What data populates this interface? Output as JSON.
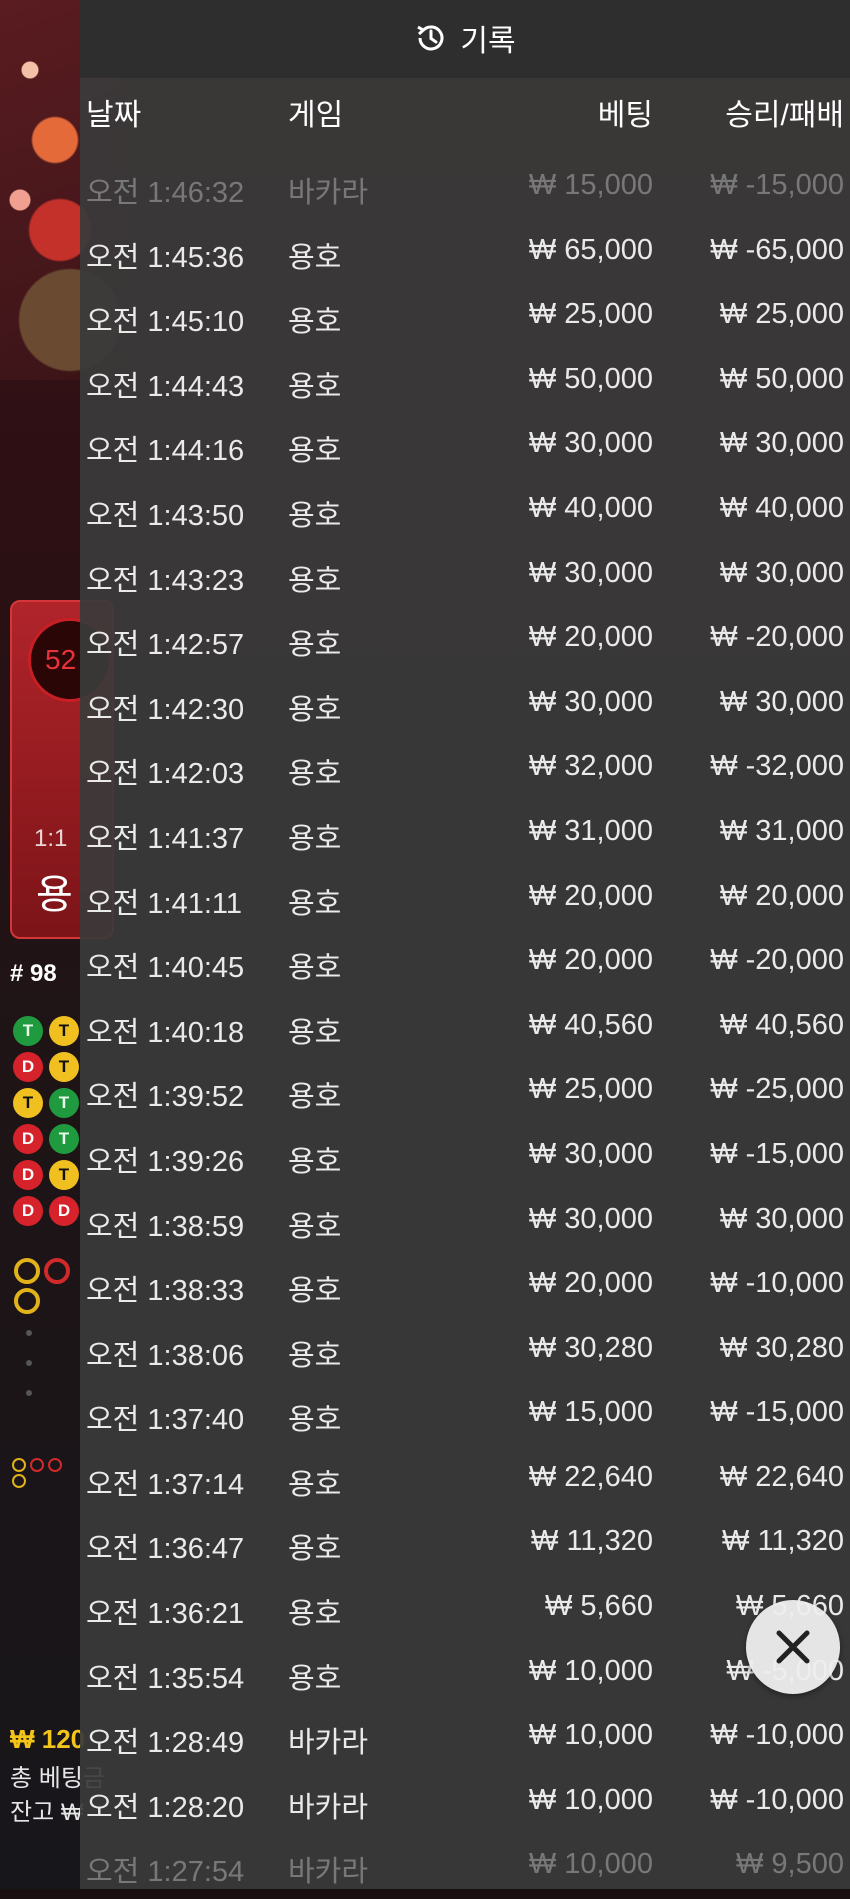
{
  "background": {
    "card_number": "52",
    "odds": "1:1",
    "dragon_label": "용",
    "round": "# 98",
    "balance_partial": "₩ 120",
    "total_bet_label": "총 베팅금",
    "remaining_label": "잔고 ₩"
  },
  "header": {
    "title": "기록",
    "icon": "history-icon"
  },
  "columns": {
    "date": "날짜",
    "game": "게임",
    "bet": "베팅",
    "win_loss": "승리/패배"
  },
  "rows": [
    {
      "time": "오전 1:46:32",
      "game": "바카라",
      "bet": "₩ 15,000",
      "result": "₩ -15,000"
    },
    {
      "time": "오전 1:45:36",
      "game": "용호",
      "bet": "₩ 65,000",
      "result": "₩ -65,000"
    },
    {
      "time": "오전 1:45:10",
      "game": "용호",
      "bet": "₩ 25,000",
      "result": "₩ 25,000"
    },
    {
      "time": "오전 1:44:43",
      "game": "용호",
      "bet": "₩ 50,000",
      "result": "₩ 50,000"
    },
    {
      "time": "오전 1:44:16",
      "game": "용호",
      "bet": "₩ 30,000",
      "result": "₩ 30,000"
    },
    {
      "time": "오전 1:43:50",
      "game": "용호",
      "bet": "₩ 40,000",
      "result": "₩ 40,000"
    },
    {
      "time": "오전 1:43:23",
      "game": "용호",
      "bet": "₩ 30,000",
      "result": "₩ 30,000"
    },
    {
      "time": "오전 1:42:57",
      "game": "용호",
      "bet": "₩ 20,000",
      "result": "₩ -20,000"
    },
    {
      "time": "오전 1:42:30",
      "game": "용호",
      "bet": "₩ 30,000",
      "result": "₩ 30,000"
    },
    {
      "time": "오전 1:42:03",
      "game": "용호",
      "bet": "₩ 32,000",
      "result": "₩ -32,000"
    },
    {
      "time": "오전 1:41:37",
      "game": "용호",
      "bet": "₩ 31,000",
      "result": "₩ 31,000"
    },
    {
      "time": "오전 1:41:11",
      "game": "용호",
      "bet": "₩ 20,000",
      "result": "₩ 20,000"
    },
    {
      "time": "오전 1:40:45",
      "game": "용호",
      "bet": "₩ 20,000",
      "result": "₩ -20,000"
    },
    {
      "time": "오전 1:40:18",
      "game": "용호",
      "bet": "₩ 40,560",
      "result": "₩ 40,560"
    },
    {
      "time": "오전 1:39:52",
      "game": "용호",
      "bet": "₩ 25,000",
      "result": "₩ -25,000"
    },
    {
      "time": "오전 1:39:26",
      "game": "용호",
      "bet": "₩ 30,000",
      "result": "₩ -15,000"
    },
    {
      "time": "오전 1:38:59",
      "game": "용호",
      "bet": "₩ 30,000",
      "result": "₩ 30,000"
    },
    {
      "time": "오전 1:38:33",
      "game": "용호",
      "bet": "₩ 20,000",
      "result": "₩ -10,000"
    },
    {
      "time": "오전 1:38:06",
      "game": "용호",
      "bet": "₩ 30,280",
      "result": "₩ 30,280"
    },
    {
      "time": "오전 1:37:40",
      "game": "용호",
      "bet": "₩ 15,000",
      "result": "₩ -15,000"
    },
    {
      "time": "오전 1:37:14",
      "game": "용호",
      "bet": "₩ 22,640",
      "result": "₩ 22,640"
    },
    {
      "time": "오전 1:36:47",
      "game": "용호",
      "bet": "₩ 11,320",
      "result": "₩ 11,320"
    },
    {
      "time": "오전 1:36:21",
      "game": "용호",
      "bet": "₩ 5,660",
      "result": "₩ 5,660"
    },
    {
      "time": "오전 1:35:54",
      "game": "용호",
      "bet": "₩ 10,000",
      "result": "₩ -5,000"
    },
    {
      "time": "오전 1:28:49",
      "game": "바카라",
      "bet": "₩ 10,000",
      "result": "₩ -10,000"
    },
    {
      "time": "오전 1:28:20",
      "game": "바카라",
      "bet": "₩ 10,000",
      "result": "₩ -10,000"
    },
    {
      "time": "오전 1:27:54",
      "game": "바카라",
      "bet": "₩ 10,000",
      "result": "₩ 9,500"
    }
  ],
  "close_button": {
    "icon": "close-icon"
  }
}
